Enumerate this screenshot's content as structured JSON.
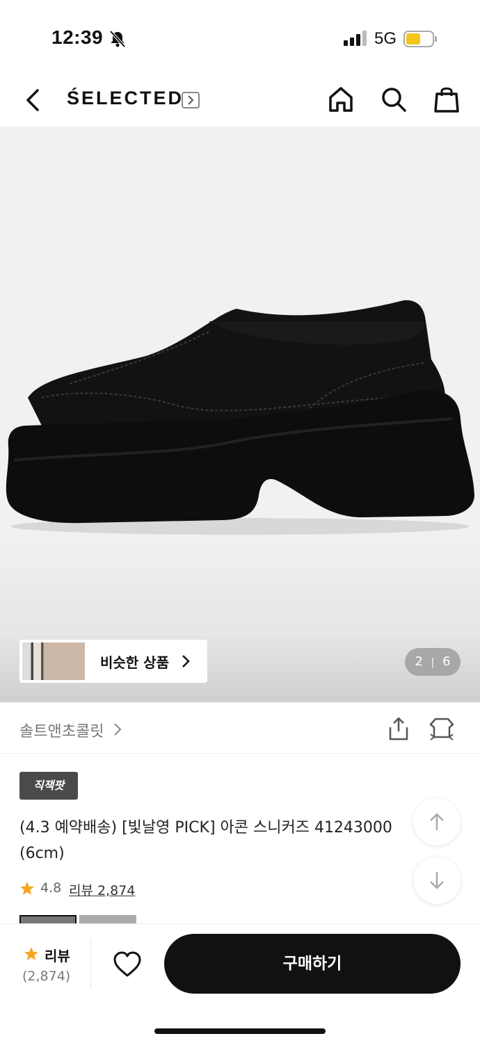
{
  "status_bar": {
    "time": "12:39",
    "network": "5G"
  },
  "nav": {
    "brand": "ŚELECTED"
  },
  "gallery": {
    "similar_label": "비슷한 상품",
    "page_current": "2",
    "page_total": "6",
    "page_separator": "|"
  },
  "brand_row": {
    "name": "솔트앤초콜릿"
  },
  "product": {
    "badge": "직잭팟",
    "title": "(4.3 예약배송) [빛날영 PICK] 아콘 스니커즈 41243000 (6cm)",
    "rating": "4.8",
    "review_link": "리뷰 2,874"
  },
  "bottom_bar": {
    "review_label": "리뷰",
    "review_count": "(2,874)",
    "buy_label": "구매하기"
  },
  "colors": {
    "accent_star": "#f5a623",
    "buy_button": "#111111",
    "battery": "#f5c518"
  },
  "icons": [
    "bell-off-icon",
    "signal-icon",
    "battery-icon",
    "back-icon",
    "home-icon",
    "search-icon",
    "bag-icon",
    "chevron-right-icon",
    "share-icon",
    "fitting-icon",
    "star-icon",
    "heart-icon",
    "arrow-up-icon",
    "arrow-down-icon"
  ]
}
